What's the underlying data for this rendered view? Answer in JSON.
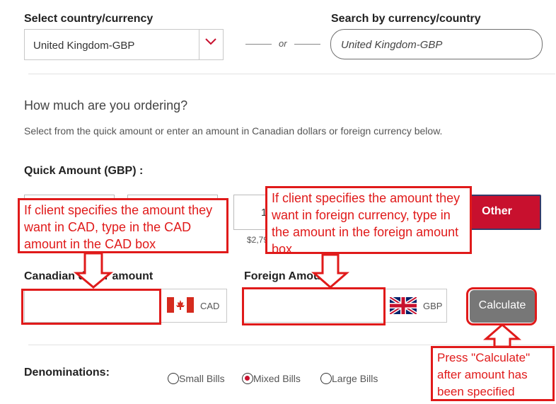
{
  "country": {
    "label": "Select country/currency",
    "selected": "United Kingdom-GBP"
  },
  "or_text": "or",
  "search": {
    "label": "Search by currency/country",
    "value": "United Kingdom-GBP"
  },
  "ordering": {
    "question": "How much are you ordering?",
    "helper": "Select from the quick amount or enter an amount in Canadian dollars or foreign currency below."
  },
  "quick_amount": {
    "label": "Quick Amount (GBP) :",
    "partial_amount": "1",
    "partial_subtext": "$2,79",
    "other_label": "Other"
  },
  "cad": {
    "label": "Canadian dollar amount",
    "value": "",
    "code": "CAD"
  },
  "foreign": {
    "label": "Foreign Amount",
    "value": "",
    "code": "GBP"
  },
  "calculate_label": "Calculate",
  "denominations": {
    "label": "Denominations:",
    "options": [
      "Small Bills",
      "Mixed Bills",
      "Large Bills"
    ],
    "selected": "Mixed Bills"
  },
  "annotations": {
    "cad_note": "If client specifies the amount they want in CAD, type in the CAD amount in the CAD box",
    "foreign_note": "If client specifies the amount they want in foreign currency, type in the amount in the foreign amount box",
    "calc_note": "Press \"Calculate\" after amount has been specified"
  },
  "colors": {
    "brand_red": "#c8102e",
    "annotation_red": "#e01a1a",
    "calculate_gray": "#777777"
  },
  "icons": {
    "chevron": "chevron-down-icon",
    "cad_flag": "canada-flag-icon",
    "gbp_flag": "uk-flag-icon"
  }
}
